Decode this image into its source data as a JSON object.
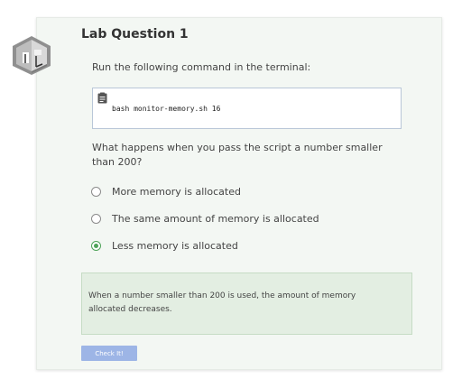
{
  "lab": {
    "title": "Lab Question 1",
    "icon": "lab-room-icon"
  },
  "instruction": "Run the following command in the terminal:",
  "code": {
    "icon": "document-icon",
    "command": "bash monitor-memory.sh 16"
  },
  "question": "What happens when you pass the script a number smaller than 200?",
  "options": [
    {
      "label": "More memory is allocated",
      "selected": false
    },
    {
      "label": "The same amount of memory is allocated",
      "selected": false
    },
    {
      "label": "Less memory is allocated",
      "selected": true
    }
  ],
  "feedback": "When a number smaller than 200 is used, the amount of memory allocated decreases.",
  "button": {
    "label": "Check It!"
  },
  "colors": {
    "card_background": "#f3f7f3",
    "selected_radio": "#4fa35a",
    "feedback_background": "#e3eee2",
    "button_background": "#9db5e6"
  }
}
